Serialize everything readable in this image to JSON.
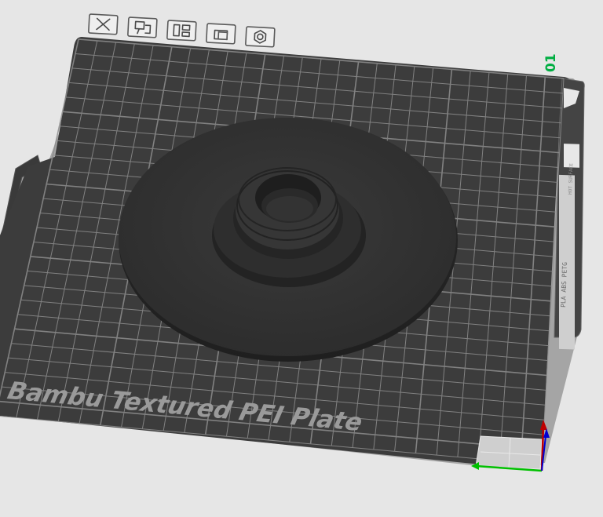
{
  "toolbar": {
    "buttons": [
      {
        "name": "remove-plate-button",
        "icon": "close-icon",
        "label": "Remove plate"
      },
      {
        "name": "arrange-button",
        "icon": "arrange-icon",
        "label": "Arrange"
      },
      {
        "name": "auto-orient-button",
        "icon": "orient-icon",
        "label": "Auto orient"
      },
      {
        "name": "lock-plate-button",
        "icon": "lock-icon",
        "label": "Lock"
      },
      {
        "name": "plate-settings-button",
        "icon": "gear-icon",
        "label": "Plate settings"
      }
    ]
  },
  "plate": {
    "number": "01",
    "name": "Bambu Textured PEI Plate",
    "side_label": "PLA ABS PETG",
    "side_caption": "HOT SURFACE"
  },
  "colors": {
    "background": "#e6e6e6",
    "plate": "#3c3c3c",
    "grid": "#8e8e8e",
    "plate_number": "#00ae42",
    "axis_x": "#00c000",
    "axis_y": "#c00000",
    "axis_z": "#0000d0"
  }
}
